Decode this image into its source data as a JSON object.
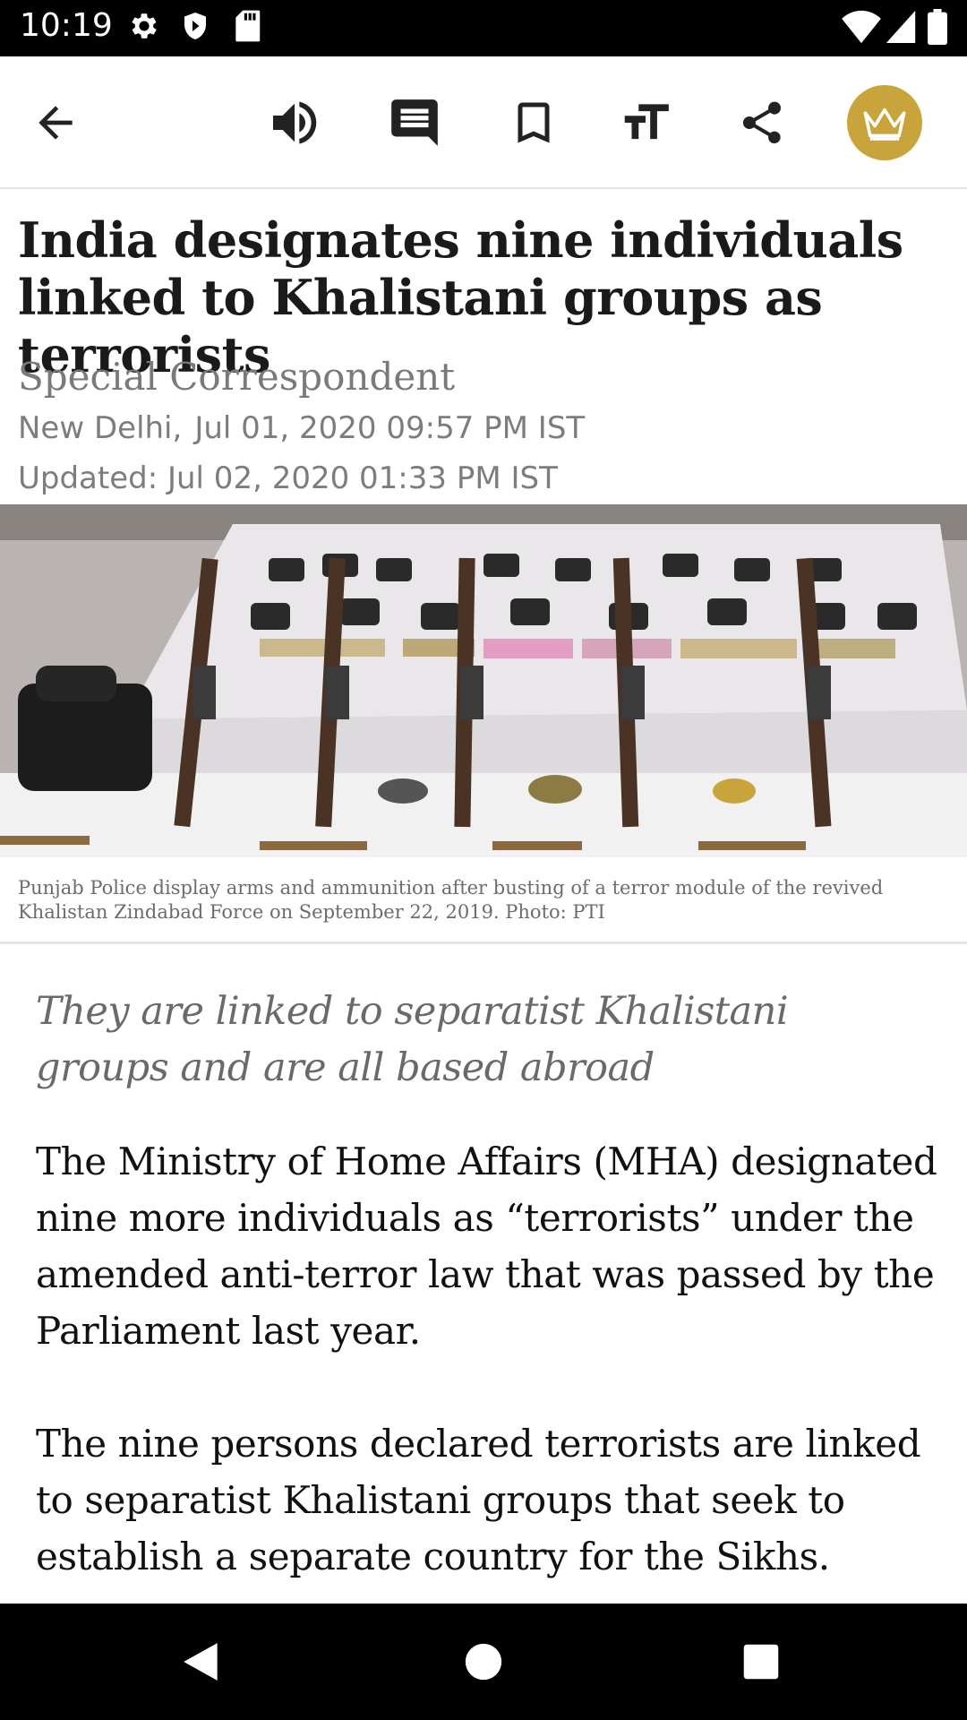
{
  "status_bar": {
    "time": "10:19",
    "icons_left": [
      "gear-icon",
      "shield-icon",
      "sd-card-icon"
    ],
    "icons_right": [
      "wifi-icon",
      "signal-icon",
      "battery-icon"
    ]
  },
  "toolbar": {
    "actions": [
      "back-arrow-icon",
      "speaker-icon",
      "comment-icon",
      "bookmark-icon",
      "text-size-icon",
      "share-icon",
      "crown-icon"
    ],
    "premium_color": "#c9a43b"
  },
  "article": {
    "headline": "India designates nine individuals linked to Khalistani groups as terrorists",
    "byline": "Special Correspondent",
    "location": "New Delhi,",
    "published": "Jul 01, 2020 09:57 PM IST",
    "updated": "Updated: Jul 02, 2020 01:33 PM IST",
    "image_caption": "Punjab Police display arms and ammunition after busting of a terror module of the revived Khalistan Zindabad Force on September 22, 2019. Photo: PTI",
    "summary": "They are linked to separatist Khalistani groups and are all based abroad",
    "paragraphs": [
      "The Ministry of Home Affairs (MHA) designated nine more individuals as “terrorists” under the amended anti-terror law that was passed by the Parliament last year.",
      "The nine persons declared terrorists are linked to separatist Khalistani groups that seek to establish a separate country for the Sikhs."
    ]
  },
  "nav_bar": {
    "buttons": [
      "nav-back-icon",
      "nav-home-icon",
      "nav-recents-icon"
    ]
  }
}
